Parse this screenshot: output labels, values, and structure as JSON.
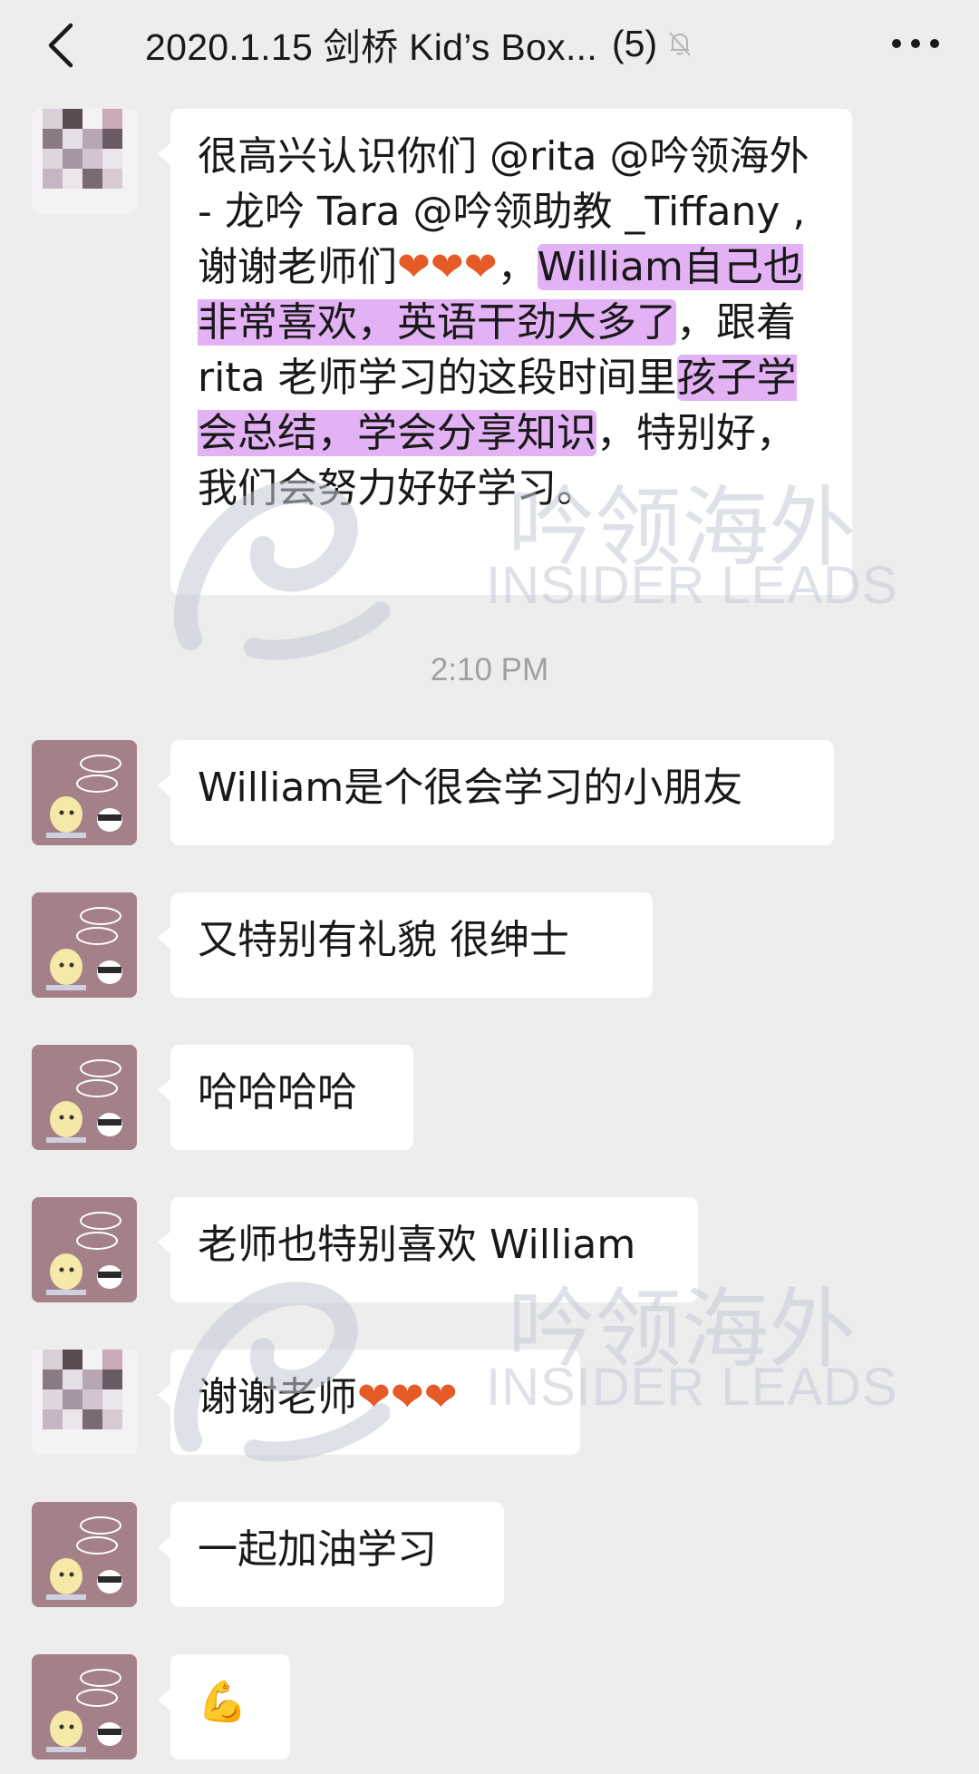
{
  "header": {
    "title": "2020.1.15 剑桥 Kid’s Box...",
    "member_count": "(5)",
    "back_icon": "chevron-left-icon",
    "mute_icon": "bell-muted-icon",
    "more_icon": "more-dots-icon"
  },
  "messages": [
    {
      "sender": "parent",
      "segments": [
        {
          "text": "很高兴认识你们 @rita @吟领海外 - 龙吟 Tara @吟领助教 _Tiffany ,谢谢老师们",
          "hl": false
        },
        {
          "text": "❤❤❤",
          "heart": true
        },
        {
          "text": "，",
          "hl": false
        },
        {
          "text": "William自己也非常喜欢，英语干劲大多了",
          "hl": true
        },
        {
          "text": "，跟着 rita 老师学习的这段时间里",
          "hl": false
        },
        {
          "text": "孩子学会总结，学会分享知识",
          "hl": true
        },
        {
          "text": "，特别好，我们会努力好好学习。",
          "hl": false
        }
      ]
    }
  ],
  "timestamp": "2:10 PM",
  "teacher_messages": [
    {
      "text": "William是个很会学习的小朋友"
    },
    {
      "text": "又特别有礼貌 很绅士"
    },
    {
      "text": "哈哈哈哈"
    },
    {
      "text": "老师也特别喜欢 William"
    }
  ],
  "parent_reply": {
    "text": "谢谢老师",
    "hearts": "❤❤❤"
  },
  "teacher_followups": [
    {
      "text": "一起加油学习"
    },
    {
      "text": "💪"
    }
  ],
  "watermark": {
    "cn": "吟领海外",
    "en": "INSIDER LEADS"
  },
  "colors": {
    "background": "#ededed",
    "bubble": "#ffffff",
    "highlight": "#e3b2f5",
    "heart": "#e55a26",
    "teacher_avatar": "#a48088"
  }
}
